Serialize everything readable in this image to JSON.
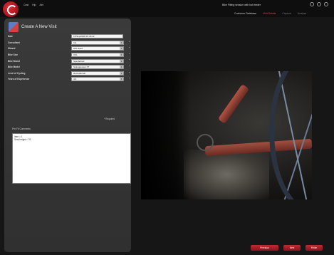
{
  "app": {
    "menu": [
      "Cust",
      "Hlp",
      "Abt"
    ],
    "session_title": "Bike Fitting session with bob tester"
  },
  "nav": {
    "tabs": [
      {
        "label": "Customer Database",
        "state": "normal"
      },
      {
        "label": "Visit Details",
        "state": "active"
      },
      {
        "label": "Capture",
        "state": "inactive"
      },
      {
        "label": "Analyse",
        "state": "inactive"
      }
    ]
  },
  "panel": {
    "title": "Create A New Visit",
    "fields": [
      {
        "label": "Date",
        "value": "15/Sep/2008 15:46:42",
        "type": "text",
        "required": false
      },
      {
        "label": "Consultant",
        "value": "tmt",
        "type": "select",
        "required": true
      },
      {
        "label": "Wizard",
        "value": "DW Road",
        "type": "select",
        "required": true
      },
      {
        "label": "Bike Size",
        "value": "XXL",
        "type": "select",
        "required": true
      },
      {
        "label": "Bike Brand",
        "value": "Specialized",
        "type": "select",
        "required": true
      },
      {
        "label": "Bike Model",
        "value": "Stumpjumper FT",
        "type": "select",
        "required": true
      },
      {
        "label": "Level of Cycling",
        "value": "Recreational",
        "type": "select",
        "required": true
      },
      {
        "label": "Years of Experience",
        "value": "4-6",
        "type": "select",
        "required": true
      }
    ],
    "required_note": "* Required",
    "comments_label": "Pre-Fit Comments",
    "comments_text": "Item = 1\nSeat height = 76"
  },
  "buttons": {
    "previous": "Previous",
    "next": "Next",
    "finish": "Finish"
  },
  "colors": {
    "accent": "#c02a34",
    "active_tab": "#e64052",
    "panel_bg": "#363636",
    "app_bg": "#161616"
  },
  "icons": {
    "logo": "app-logo-icon",
    "visit": "new-visit-icon",
    "dropdown": "chevron-down-icon"
  }
}
